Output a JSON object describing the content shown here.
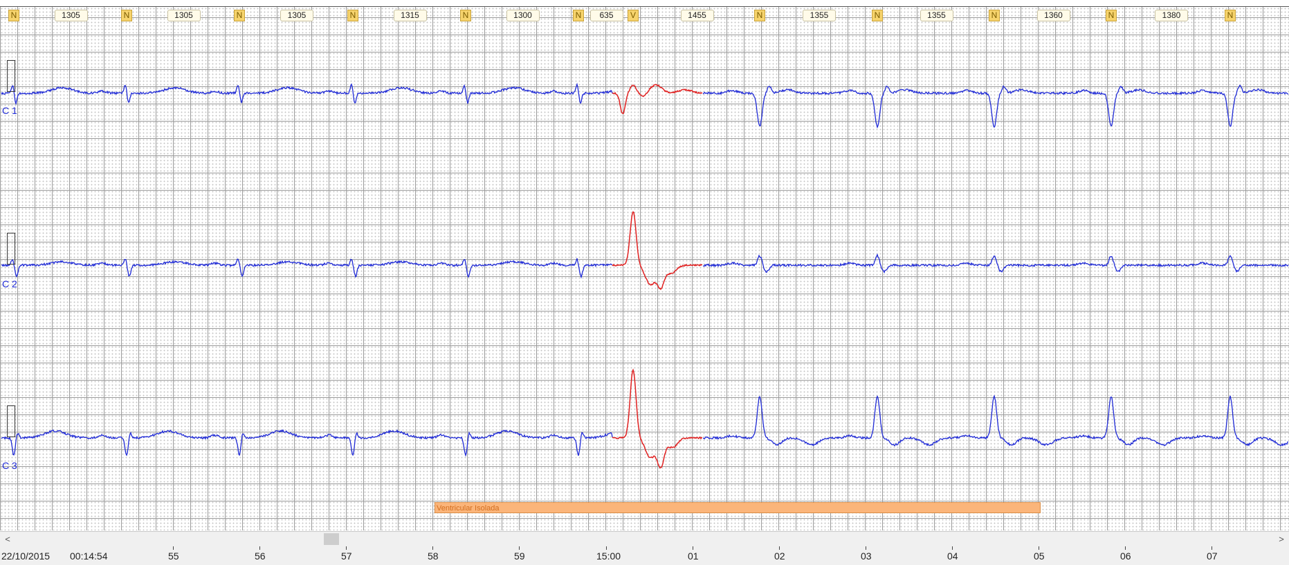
{
  "annotations": {
    "beats": [
      {
        "cls": "N",
        "rr": "1305"
      },
      {
        "cls": "N",
        "rr": "1305"
      },
      {
        "cls": "N",
        "rr": "1305"
      },
      {
        "cls": "N",
        "rr": "1315"
      },
      {
        "cls": "N",
        "rr": "1300"
      },
      {
        "cls": "N",
        "rr": "635"
      },
      {
        "cls": "V",
        "rr": "1455"
      },
      {
        "cls": "N",
        "rr": "1355"
      },
      {
        "cls": "N",
        "rr": "1355"
      },
      {
        "cls": "N",
        "rr": "1360"
      },
      {
        "cls": "N",
        "rr": "1380"
      },
      {
        "cls": "N",
        "rr": ""
      }
    ]
  },
  "channels": [
    {
      "label": "C 1"
    },
    {
      "label": "C 2"
    },
    {
      "label": "C 3"
    }
  ],
  "event": {
    "label": "Ventricular Isolada"
  },
  "time_axis": {
    "date": "22/10/2015",
    "start_time": "00:14:54",
    "ticks": [
      "55",
      "56",
      "57",
      "58",
      "59",
      "15:00",
      "01",
      "02",
      "03",
      "04",
      "05",
      "06",
      "07"
    ]
  },
  "scrollbar": {
    "left_arrow": "<",
    "right_arrow": ">"
  },
  "colors": {
    "normal_trace": "#1f2ad6",
    "ventricular_trace": "#e02020",
    "event_bar": "#fbb57a",
    "class_badge": "#f6d36c"
  }
}
